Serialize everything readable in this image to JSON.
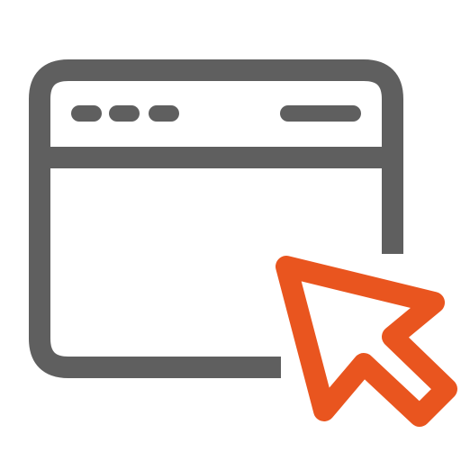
{
  "icon": {
    "name": "browser-window-cursor-icon",
    "parts": [
      "browser-window-icon",
      "window-dots-icon",
      "address-bar-icon",
      "cursor-arrow-icon"
    ],
    "colors": {
      "window_stroke": "#5f5f5f",
      "cursor_stroke": "#e9551f",
      "background": "#ffffff"
    }
  }
}
